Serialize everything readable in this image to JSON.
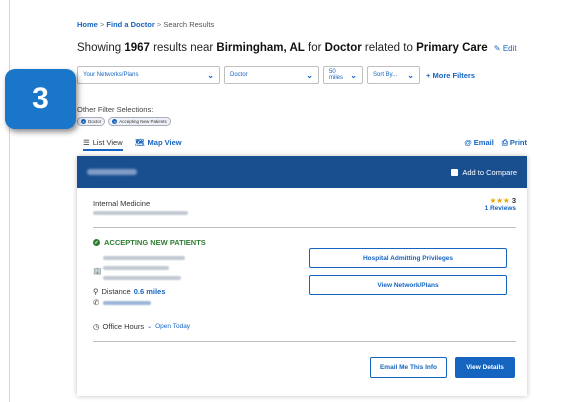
{
  "step": "3",
  "breadcrumb": {
    "home": "Home",
    "sep": ">",
    "find": "Find a Doctor",
    "current": "Search Results"
  },
  "headline": {
    "prefix": "Showing",
    "count": "1967",
    "mid1": "results near",
    "location": "Birmingham, AL",
    "mid2": "for",
    "term": "Doctor",
    "mid3": "related to",
    "category": "Primary Care",
    "edit": "Edit"
  },
  "filters": {
    "networks": "Your Networks/Plans",
    "type": "Doctor",
    "distance": "50 miles",
    "sort": "Sort By...",
    "more": "More Filters"
  },
  "other_filters": {
    "title": "Other Filter Selections:",
    "chips": [
      "Doctor",
      "Accepting New Patients"
    ]
  },
  "views": {
    "list": "List View",
    "map": "Map View",
    "email": "Email",
    "print": "Print"
  },
  "result": {
    "compare": "Add to Compare",
    "specialty": "Internal Medicine",
    "rating_value": 3,
    "rating_text": "3",
    "reviews": "1 Reviews",
    "accepting": "ACCEPTING NEW PATIENTS",
    "distance_label": "Distance",
    "distance_value": "0.6 miles",
    "hours_label": "Office Hours",
    "hours_status": "Open Today",
    "hospital_btn": "Hospital Admitting Privileges",
    "network_btn": "View Network/Plans",
    "email_btn": "Email Me This Info",
    "details_btn": "View Details"
  },
  "colors": {
    "accent": "#1565c0",
    "header": "#1a4f8f",
    "badge": "#1976c9",
    "success": "#2e7d32",
    "star": "#e4a600"
  }
}
